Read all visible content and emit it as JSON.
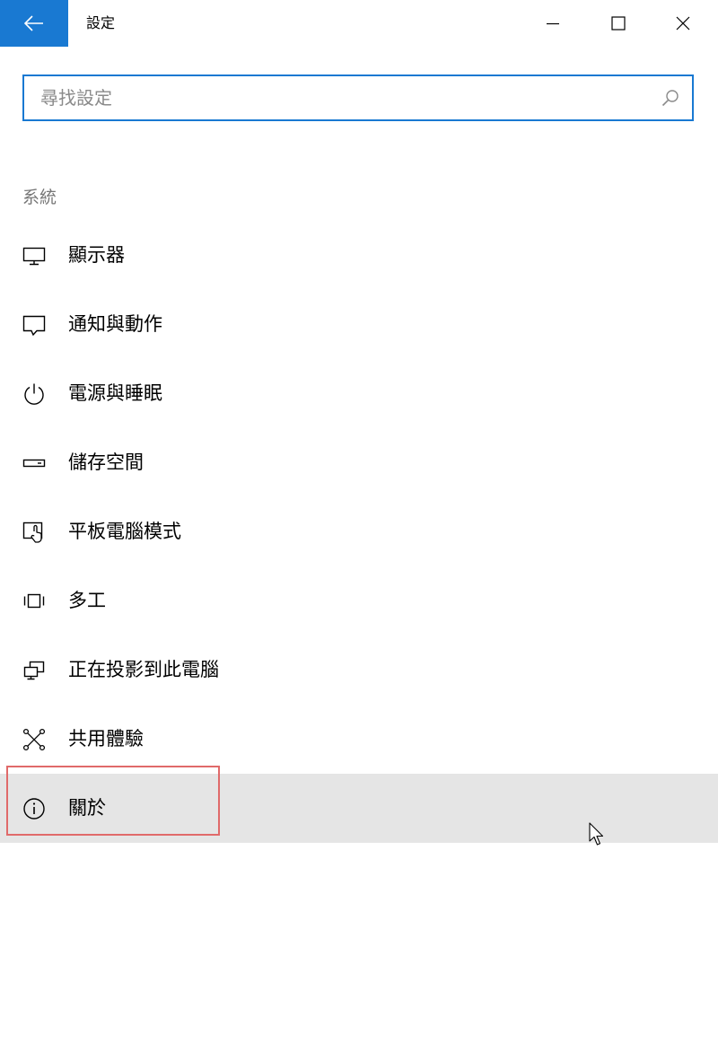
{
  "window": {
    "title": "設定",
    "back_label": "返回",
    "minimize_label": "最小化",
    "maximize_label": "最大化",
    "close_label": "關閉"
  },
  "search": {
    "placeholder": "尋找設定",
    "value": ""
  },
  "section": {
    "heading": "系統"
  },
  "nav": {
    "items": [
      {
        "label": "顯示器",
        "icon": "display-icon"
      },
      {
        "label": "通知與動作",
        "icon": "notification-icon"
      },
      {
        "label": "電源與睡眠",
        "icon": "power-icon"
      },
      {
        "label": "儲存空間",
        "icon": "storage-icon"
      },
      {
        "label": "平板電腦模式",
        "icon": "tablet-mode-icon"
      },
      {
        "label": "多工",
        "icon": "multitasking-icon"
      },
      {
        "label": "正在投影到此電腦",
        "icon": "projecting-icon"
      },
      {
        "label": "共用體驗",
        "icon": "shared-experiences-icon"
      },
      {
        "label": "關於",
        "icon": "info-icon"
      }
    ],
    "selected_index": 8
  },
  "colors": {
    "accent": "#1979d2",
    "selected_row": "#e5e5e5",
    "highlight_border": "#e06a6a",
    "section_heading": "#767676"
  }
}
